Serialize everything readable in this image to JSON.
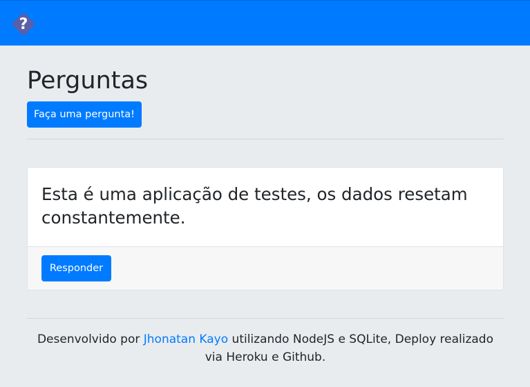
{
  "navbar": {
    "logo_icon": "question-diamond-icon",
    "logo_text": "?",
    "brand_color": "#007bff",
    "logo_color": "#5b5fa6"
  },
  "main": {
    "title": "Perguntas",
    "ask_button_label": "Faça uma pergunta!"
  },
  "questions": [
    {
      "text": "Esta é uma aplicação de testes, os dados resetam constantemente.",
      "answer_button_label": "Responder"
    }
  ],
  "footer": {
    "prefix": "Desenvolvido por ",
    "author_link": "Jhonatan Kayo",
    "suffix": " utilizando NodeJS e SQLite, Deploy realizado via Heroku e Github."
  }
}
